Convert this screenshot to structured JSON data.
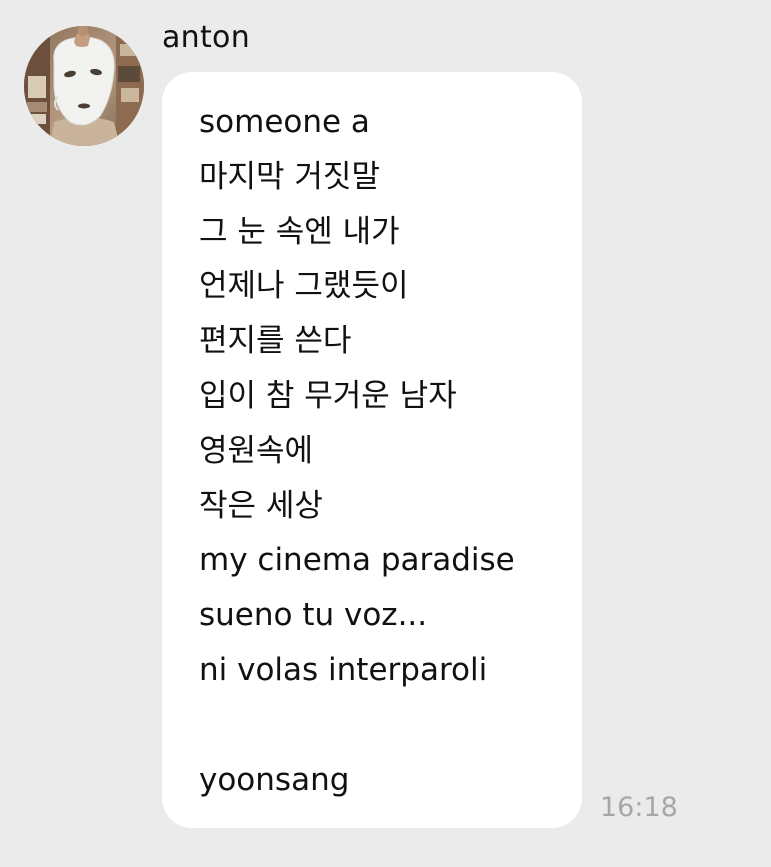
{
  "chat": {
    "sender": "anton",
    "avatar_icon": "sheet-mask-face-photo",
    "message_lines": [
      "someone a",
      "마지막 거짓말",
      "그 눈 속엔 내가",
      "언제나 그랬듯이",
      "편지를 쓴다",
      "입이 참 무거운 남자",
      "영원속에",
      "작은 세상",
      "my cinema paradise",
      "sueno tu voz...",
      "ni volas interparoli",
      "",
      "yoonsang"
    ],
    "timestamp": "16:18"
  },
  "colors": {
    "background": "#ebebeb",
    "bubble": "#ffffff",
    "text": "#111111",
    "timestamp": "#a7a7a7"
  }
}
